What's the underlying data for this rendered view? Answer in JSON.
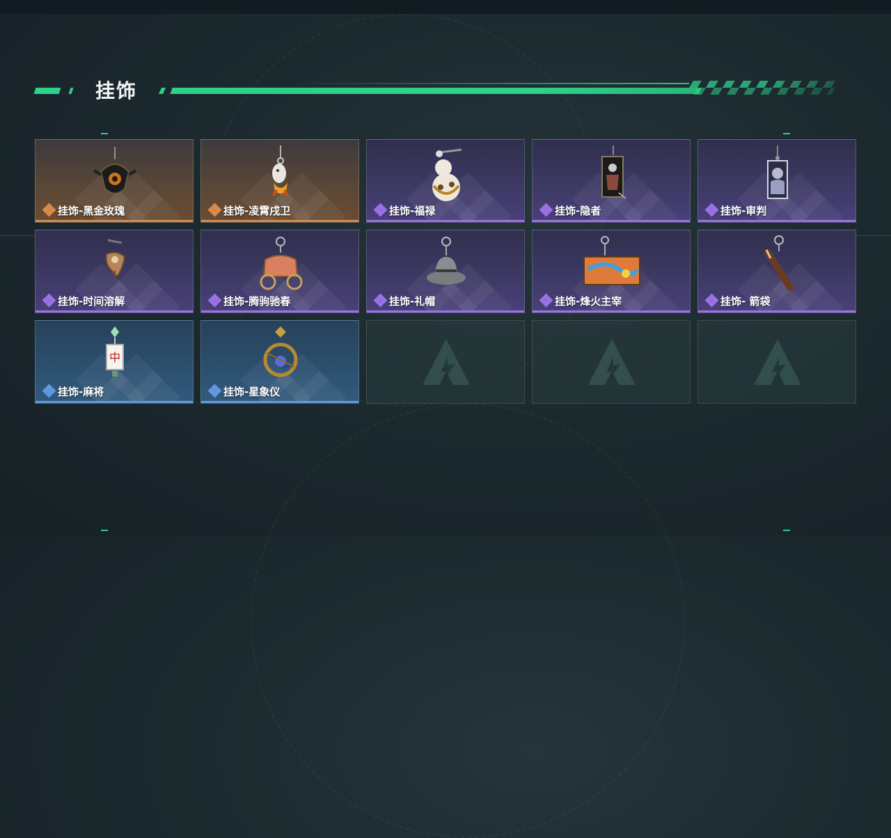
{
  "section": {
    "title": "挂饰"
  },
  "colors": {
    "accent": "#2fd08a",
    "rarity_orange": "#d98b4b",
    "rarity_purple": "#9a72e6",
    "rarity_blue": "#5f9ae0"
  },
  "items": [
    {
      "label": "挂饰-黑金玫瑰",
      "rarity": "orange",
      "icon": "black-gold-rose-pendant-icon"
    },
    {
      "label": "挂饰-凌霄戌卫",
      "rarity": "orange",
      "icon": "dog-guard-pendant-icon"
    },
    {
      "label": "挂饰-福禄",
      "rarity": "purple",
      "icon": "gourd-pendant-icon"
    },
    {
      "label": "挂饰-隐者",
      "rarity": "purple",
      "icon": "hermit-card-pendant-icon"
    },
    {
      "label": "挂饰-审判",
      "rarity": "purple",
      "icon": "judgement-card-pendant-icon"
    },
    {
      "label": "挂饰-时间溶解",
      "rarity": "purple",
      "icon": "melting-clock-pendant-icon"
    },
    {
      "label": "挂饰-腾驹驰春",
      "rarity": "purple",
      "icon": "carriage-pendant-icon"
    },
    {
      "label": "挂饰-礼帽",
      "rarity": "purple",
      "icon": "top-hat-pendant-icon"
    },
    {
      "label": "挂饰-烽火主宰",
      "rarity": "purple",
      "icon": "graffiti-plate-pendant-icon"
    },
    {
      "label": "挂饰- 箭袋",
      "rarity": "purple",
      "icon": "quiver-pendant-icon"
    },
    {
      "label": "挂饰-麻将",
      "rarity": "blue",
      "icon": "mahjong-tile-pendant-icon"
    },
    {
      "label": "挂饰-星象仪",
      "rarity": "blue",
      "icon": "astrolabe-pendant-icon"
    }
  ],
  "empty_slots": 3,
  "empty_icon": "game-logo-icon"
}
